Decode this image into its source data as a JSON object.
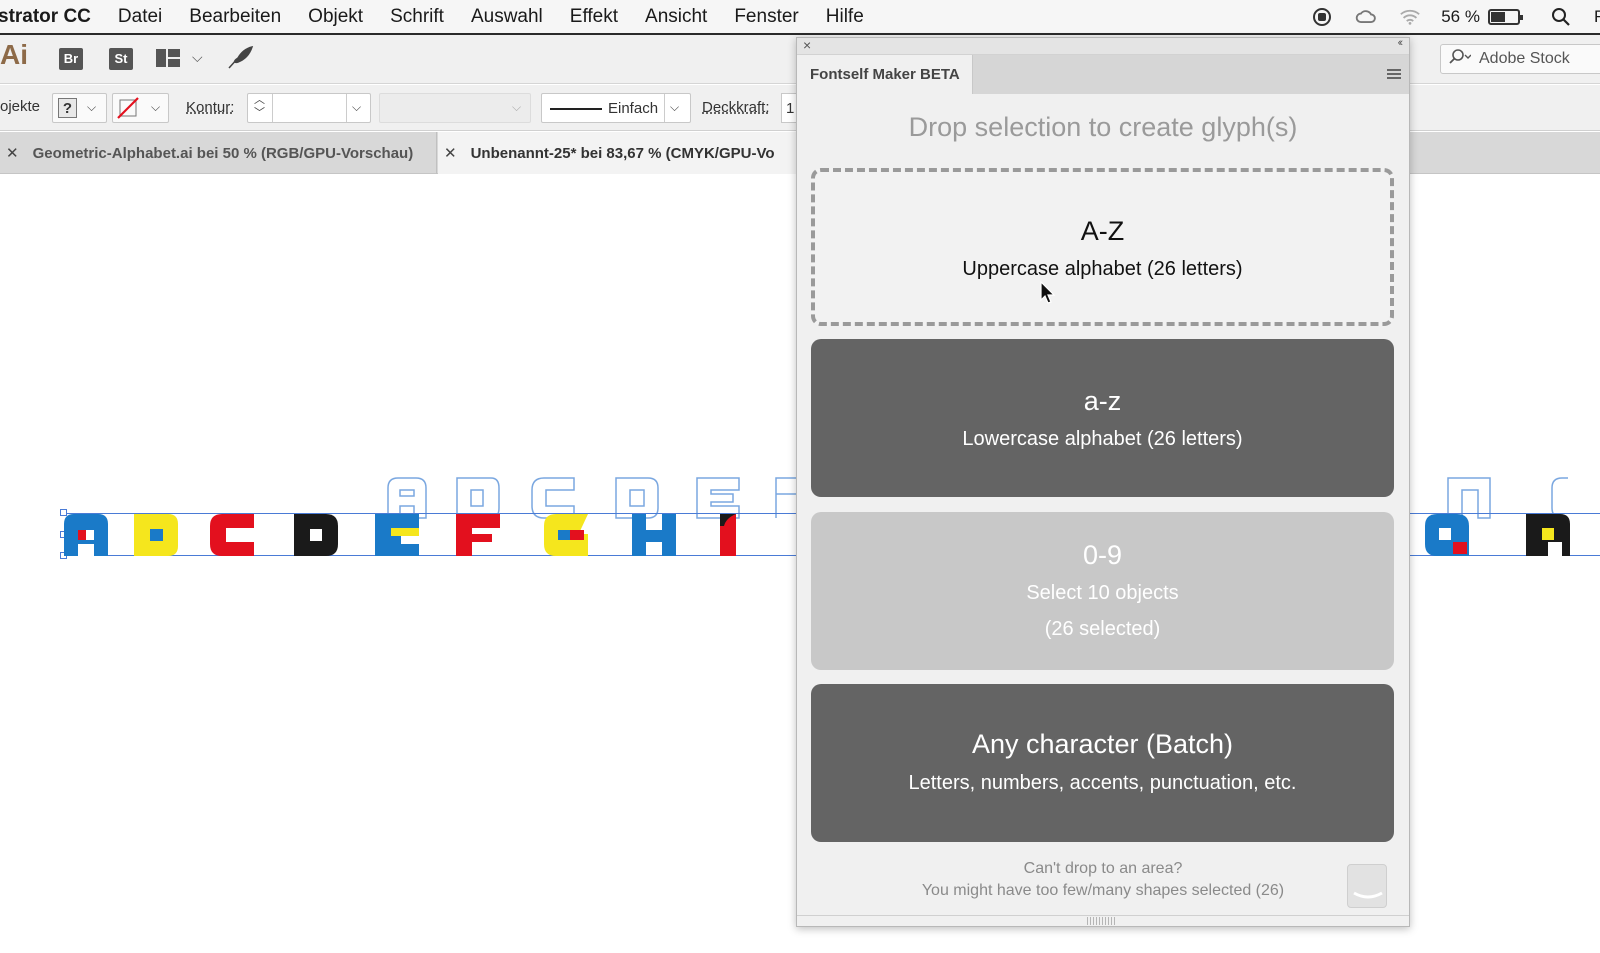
{
  "menubar": {
    "app_name": "strator CC",
    "menus": [
      "Datei",
      "Bearbeiten",
      "Objekt",
      "Schrift",
      "Auswahl",
      "Effekt",
      "Ansicht",
      "Fenster",
      "Hilfe"
    ],
    "battery_percent": "56 %",
    "battery_level": 0.56,
    "user_initial": "Fr",
    "icons": [
      "record-icon",
      "creative-cloud-icon",
      "wifi-icon",
      "battery-icon",
      "spotlight-search-icon"
    ]
  },
  "appbar": {
    "app_logo": "Ai",
    "bridge_label": "Br",
    "stock_app_label": "St",
    "stock_search_placeholder": "Adobe Stock"
  },
  "controlbar": {
    "objects_label": "ojekte",
    "fill_value": "?",
    "kontur_label": "Kontur:",
    "stroke_style_label": "Einfach",
    "opacity_label": "Deckkraft:",
    "opacity_value": "1"
  },
  "tabs": [
    {
      "label": "Geometric-Alphabet.ai bei 50 % (RGB/GPU-Vorschau)",
      "active": false
    },
    {
      "label": "Unbenannt-25* bei 83,67 % (CMYK/GPU-Vo",
      "active": true
    }
  ],
  "canvas": {
    "glyph_colors": {
      "blue": "#1a7ac8",
      "yellow": "#f5e61d",
      "red": "#e3101e",
      "black": "#1a1a1a",
      "outline": "#7aa7e0"
    },
    "glyphs_visible": [
      "A",
      "B",
      "C",
      "D",
      "E",
      "F",
      "G",
      "H",
      "I",
      "Q",
      "R"
    ],
    "outline_letters_visible": [
      "A",
      "B",
      "C",
      "D",
      "E",
      "N",
      "O"
    ]
  },
  "panel": {
    "tab_title": "Fontself Maker BETA",
    "heading": "Drop selection to create glyph(s)",
    "cards": {
      "uppercase": {
        "title": "A-Z",
        "subtitle": "Uppercase alphabet (26 letters)"
      },
      "lowercase": {
        "title": "a-z",
        "subtitle": "Lowercase alphabet (26 letters)"
      },
      "digits": {
        "title": "0-9",
        "subtitle": "Select 10 objects",
        "note": "(26 selected)"
      },
      "batch": {
        "title": "Any character (Batch)",
        "subtitle": "Letters, numbers, accents, punctuation, etc."
      }
    },
    "footer": {
      "line1": "Can't drop to an area?",
      "line2": "You might have too few/many shapes selected (26)"
    }
  }
}
